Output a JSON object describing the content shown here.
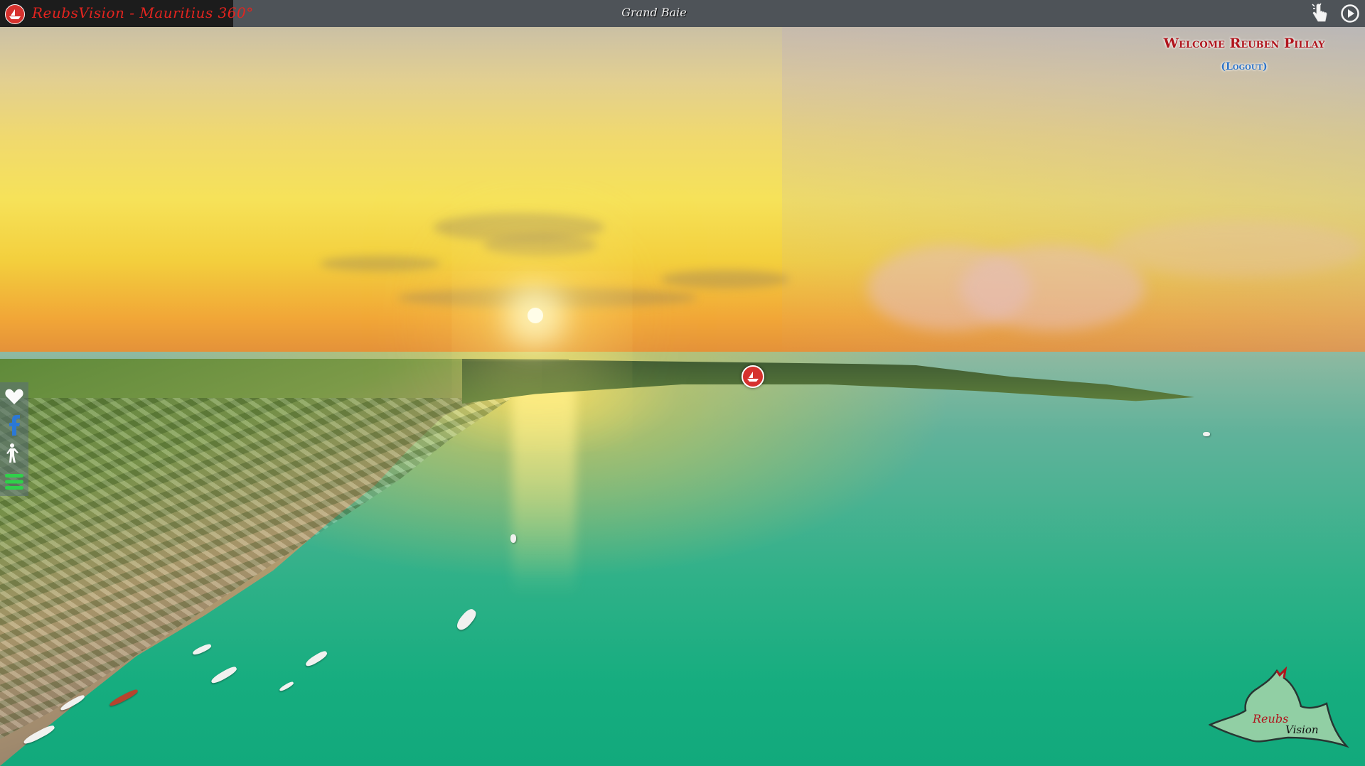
{
  "app": {
    "title": "ReubsVision - Mauritius 360°",
    "location": "Grand Baie"
  },
  "user": {
    "welcome": "Welcome Reuben Pillay",
    "logout": "(Logout)"
  },
  "toolbar": {
    "icons": [
      "hand-pointer-icon",
      "play-icon"
    ]
  },
  "sidebar": {
    "icons": [
      "heart-icon",
      "facebook-icon",
      "person-icon",
      "menu-icon"
    ]
  },
  "brand": {
    "name_part1": "Reubs",
    "name_part2": "Vision"
  },
  "colors": {
    "topbar": "#4e5358",
    "title_text": "#e2241f",
    "welcome_text": "#b0141c",
    "logout_text": "#2b73c9",
    "hotspot": "#d6322e",
    "menu_icon": "#2fd04a"
  }
}
